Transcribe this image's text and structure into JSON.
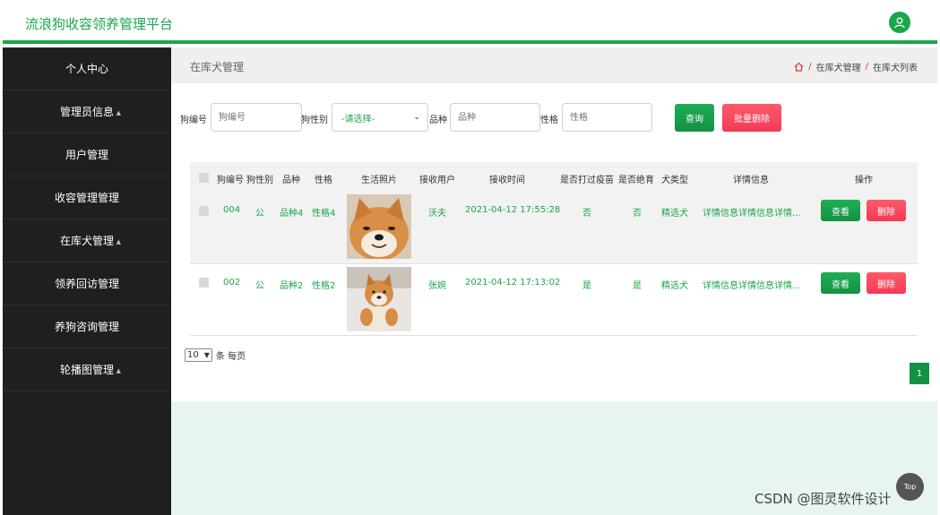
{
  "header": {
    "brand": "流浪狗收容领养管理平台",
    "avatar_icon": "user-icon"
  },
  "sidebar": {
    "items": [
      {
        "label": "个人中心",
        "expandable": false
      },
      {
        "label": "管理员信息",
        "expandable": true
      },
      {
        "label": "用户管理",
        "expandable": false
      },
      {
        "label": "收容管理管理",
        "expandable": false
      },
      {
        "label": "在库犬管理",
        "expandable": true
      },
      {
        "label": "领养回访管理",
        "expandable": false
      },
      {
        "label": "养狗咨询管理",
        "expandable": false
      },
      {
        "label": "轮播图管理",
        "expandable": true
      }
    ]
  },
  "page": {
    "title": "在库犬管理",
    "breadcrumb": [
      "在库犬管理",
      "在库犬列表"
    ],
    "breadcrumb_sep": "/"
  },
  "search": {
    "dog_no_label": "狗编号",
    "dog_no_placeholder": "狗编号",
    "sex_label": "狗性别",
    "sex_selected": "-请选择-",
    "breed_label": "品种",
    "breed_placeholder": "品种",
    "temper_label": "性格",
    "temper_placeholder": "性格",
    "query_button": "查询",
    "batch_delete_button": "批量删除"
  },
  "table": {
    "columns": [
      "狗编号",
      "狗性别",
      "品种",
      "性格",
      "生活照片",
      "接收用户",
      "接收时间",
      "是否打过疫苗",
      "是否绝育",
      "犬类型",
      "详情信息",
      "操作"
    ],
    "rows": [
      {
        "dog_no": "004",
        "sex": "公",
        "breed": "品种4",
        "temper": "性格4",
        "photo": "shiba-smiling",
        "user": "沃夫",
        "time": "2021-04-12 17:55:28",
        "vaccinated": "否",
        "neutered": "否",
        "type": "精选犬",
        "detail": "详情信息详情信息详情...",
        "view_label": "查看",
        "delete_label": "删除"
      },
      {
        "dog_no": "002",
        "sex": "公",
        "breed": "品种2",
        "temper": "性格2",
        "photo": "shiba-sitting",
        "user": "张婉",
        "time": "2021-04-12 17:13:02",
        "vaccinated": "是",
        "neutered": "是",
        "type": "精选犬",
        "detail": "详情信息详情信息详情...",
        "view_label": "查看",
        "delete_label": "删除"
      }
    ]
  },
  "pagination": {
    "page_size": "10",
    "page_size_suffix": "条 每页",
    "current_page": "1"
  },
  "misc": {
    "to_top": "Top",
    "watermark": "CSDN @图灵软件设计"
  },
  "colors": {
    "primary": "#1aa64b",
    "danger": "#f23a55",
    "sidebar": "#1f1f1f",
    "main_bg": "#e8f5ef"
  }
}
